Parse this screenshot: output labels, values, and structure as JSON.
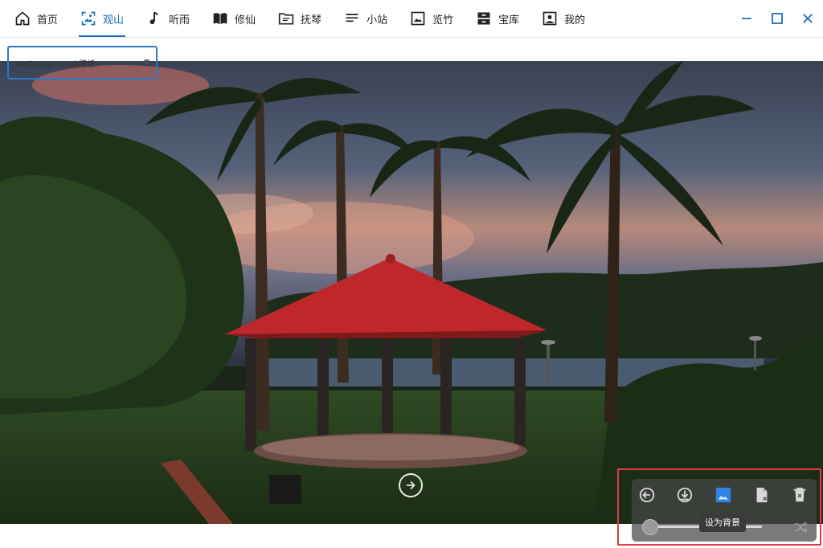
{
  "nav": {
    "items": [
      {
        "label": "首页",
        "icon": "home-icon"
      },
      {
        "label": "观山",
        "icon": "image-frame-icon"
      },
      {
        "label": "听雨",
        "icon": "music-note-icon"
      },
      {
        "label": "修仙",
        "icon": "book-icon"
      },
      {
        "label": "抚琴",
        "icon": "folder-icon"
      },
      {
        "label": "小站",
        "icon": "list-icon"
      },
      {
        "label": "览竹",
        "icon": "picture-icon"
      },
      {
        "label": "宝库",
        "icon": "storage-icon"
      },
      {
        "label": "我的",
        "icon": "user-icon"
      }
    ],
    "active_index": 1
  },
  "window_controls": [
    "minimize-icon",
    "maximize-icon",
    "close-icon"
  ],
  "viewer": {
    "source_value": "WallpaperScraft壁纸"
  },
  "controls": {
    "tooltip": "设为背景",
    "slider_value": 0.0
  },
  "colors": {
    "accent": "#1f6fb5",
    "select_border": "#2c78c9",
    "highlight_frame": "#e23b45",
    "pavilion_roof": "#c0272a"
  }
}
